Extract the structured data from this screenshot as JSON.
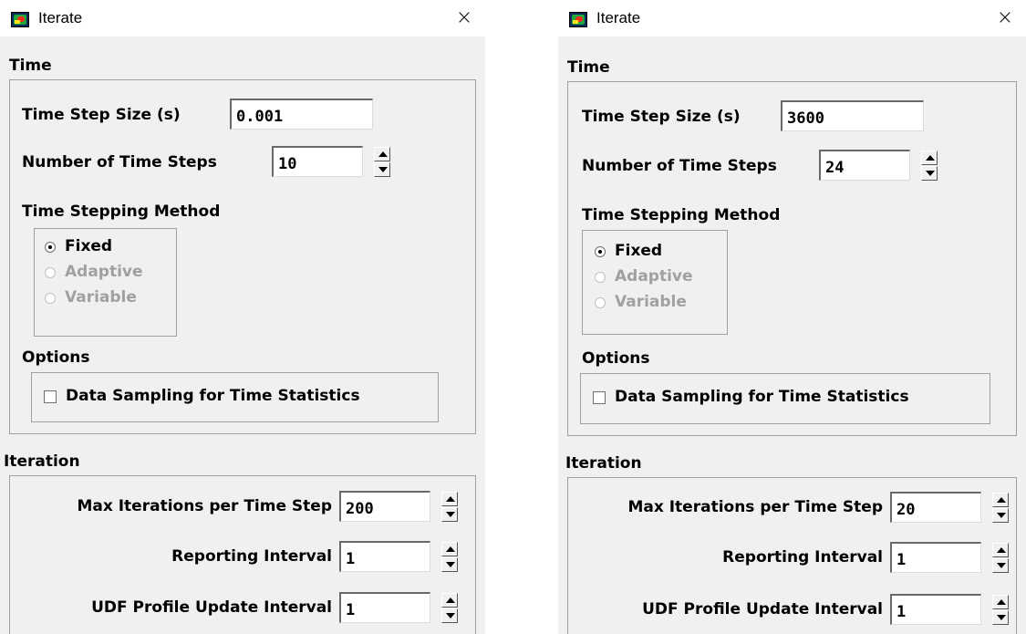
{
  "dialogs": [
    {
      "title": "Iterate",
      "close_glyph": "×",
      "time": {
        "section_label": "Time",
        "time_step_size_label": "Time Step Size (s)",
        "time_step_size_value": "0.001",
        "num_time_steps_label": "Number of Time Steps",
        "num_time_steps_value": "10",
        "stepping_method_label": "Time Stepping Method",
        "methods": [
          "Fixed",
          "Adaptive",
          "Variable"
        ],
        "selected_method": "Fixed",
        "options_label": "Options",
        "data_sampling_label": "Data Sampling for Time Statistics",
        "data_sampling_checked": false
      },
      "iteration": {
        "section_label": "Iteration",
        "max_iter_label": "Max Iterations per Time Step",
        "max_iter_value": "200",
        "reporting_label": "Reporting Interval",
        "reporting_value": "1",
        "udf_label": "UDF Profile Update Interval",
        "udf_value": "1"
      }
    },
    {
      "title": "Iterate",
      "close_glyph": "×",
      "time": {
        "section_label": "Time",
        "time_step_size_label": "Time Step Size (s)",
        "time_step_size_value": "3600",
        "num_time_steps_label": "Number of Time Steps",
        "num_time_steps_value": "24",
        "stepping_method_label": "Time Stepping Method",
        "methods": [
          "Fixed",
          "Adaptive",
          "Variable"
        ],
        "selected_method": "Fixed",
        "options_label": "Options",
        "data_sampling_label": "Data Sampling for Time Statistics",
        "data_sampling_checked": false
      },
      "iteration": {
        "section_label": "Iteration",
        "max_iter_label": "Max Iterations per Time Step",
        "max_iter_value": "20",
        "reporting_label": "Reporting Interval",
        "reporting_value": "1",
        "udf_label": "UDF Profile Update Interval",
        "udf_value": "1"
      }
    }
  ]
}
